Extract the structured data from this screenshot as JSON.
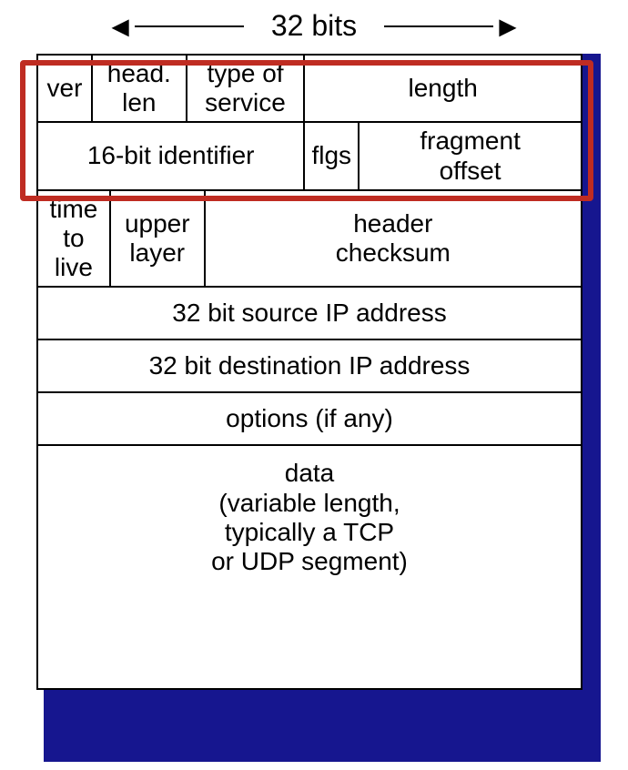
{
  "title": "32 bits",
  "rows": {
    "ver": "ver",
    "head_len": "head.\nlen",
    "tos": "type of\nservice",
    "length": "length",
    "identifier": "16-bit identifier",
    "flgs": "flgs",
    "frag_offset": "fragment\noffset",
    "ttl": "time to\nlive",
    "upper": "upper\nlayer",
    "checksum": "header\nchecksum",
    "src": "32 bit source IP address",
    "dst": "32 bit destination IP address",
    "options": "options (if any)",
    "data": "data\n(variable length,\ntypically a TCP\nor UDP segment)"
  },
  "highlight_color": "#bf2c22",
  "shadow_color": "#16168f"
}
